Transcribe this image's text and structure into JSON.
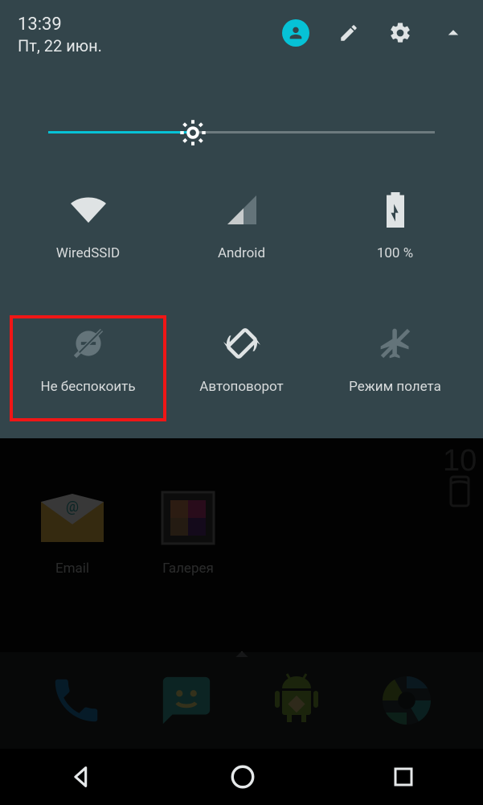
{
  "status": {
    "time": "13:39",
    "date": "Пт, 22 июн."
  },
  "brightness": {
    "percent": 37
  },
  "tiles": [
    {
      "label": "WiredSSID"
    },
    {
      "label": "Android"
    },
    {
      "label": "100 %"
    },
    {
      "label": "Не беспокоить"
    },
    {
      "label": "Автоповорот"
    },
    {
      "label": "Режим полета"
    }
  ],
  "home_apps": [
    {
      "label": "Email"
    },
    {
      "label": "Галерея"
    }
  ],
  "clock_widget": {
    "hour_tens": "10"
  }
}
